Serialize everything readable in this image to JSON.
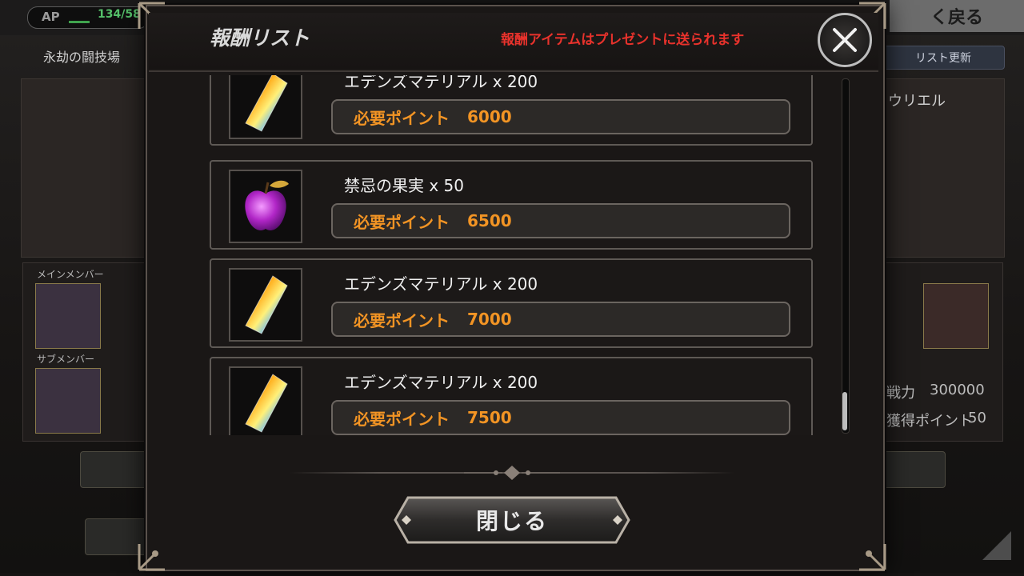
{
  "background": {
    "ap_label": "AP",
    "ap_value": "134/58",
    "back_label": "く戻る",
    "arena_title": "永劫の闘技場",
    "list_update_label": "リスト更新",
    "opponent_name": "ウリエル",
    "main_member_label": "メインメンバー",
    "sub_member_label": "サブメンバー",
    "power_label": "戦力",
    "power_value": "300000",
    "points_label": "獲得ポイント",
    "points_value": "50"
  },
  "modal": {
    "title": "報酬リスト",
    "notice": "報酬アイテムはプレゼントに送られます",
    "close_label": "閉じる",
    "rewards": [
      {
        "name": "エデンズマテリアル x 200",
        "points_label": "必要ポイント",
        "points": "6000",
        "icon": "crystal-icon"
      },
      {
        "name": "禁忌の果実 x 50",
        "points_label": "必要ポイント",
        "points": "6500",
        "icon": "apple-icon"
      },
      {
        "name": "エデンズマテリアル x 200",
        "points_label": "必要ポイント",
        "points": "7000",
        "icon": "crystal-icon"
      },
      {
        "name": "エデンズマテリアル x 200",
        "points_label": "必要ポイント",
        "points": "7500",
        "icon": "crystal-icon"
      }
    ]
  },
  "colors": {
    "notice": "#e8322c",
    "points": "#f29424"
  }
}
